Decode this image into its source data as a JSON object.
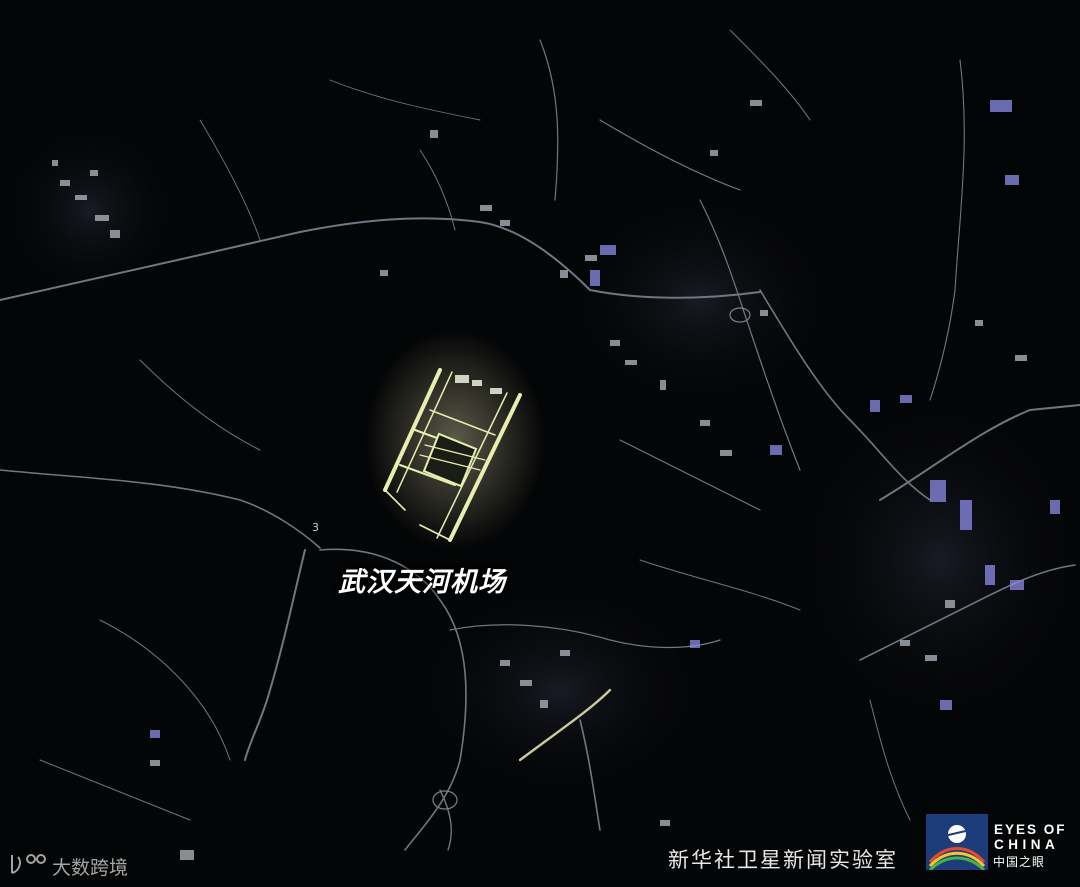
{
  "map": {
    "place_label": "武汉天河机场",
    "road_shield": "3"
  },
  "credit": {
    "text": "新华社卫星新闻实验室"
  },
  "logo": {
    "en_line1": "EYES OF",
    "en_line2": "CHINA",
    "zh": "中国之眼"
  },
  "watermark": {
    "text": "大数跨境"
  },
  "colors": {
    "background": "#040506",
    "roads": "#6f7780",
    "airport": "#e6eeb0",
    "urban": "#8c8ce8",
    "label": "#ffffff"
  }
}
